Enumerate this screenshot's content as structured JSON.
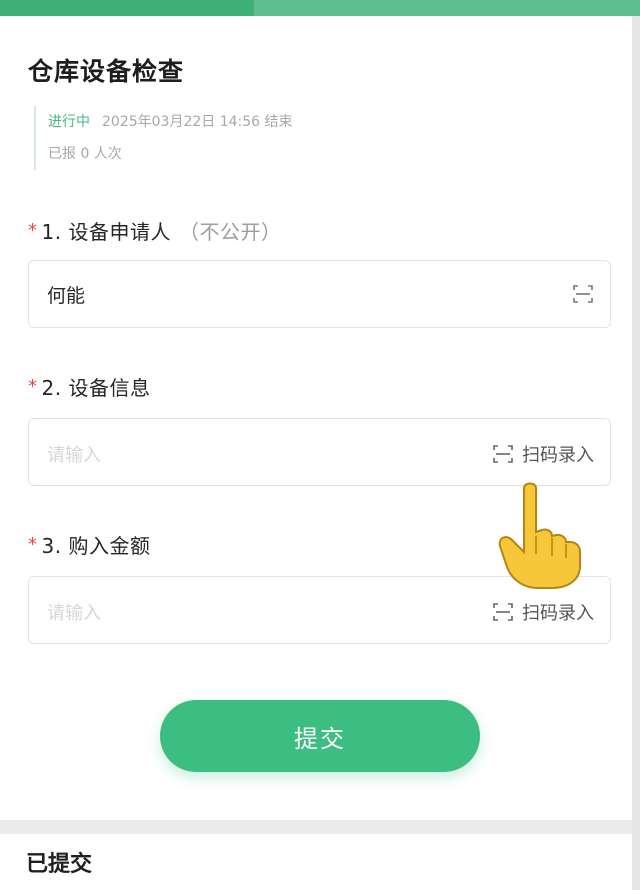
{
  "form": {
    "title": "仓库设备检查",
    "status": "进行中",
    "end_time": "2025年03月22日 14:56 结束",
    "reported": "已报 0 人次"
  },
  "questions": [
    {
      "star": "*",
      "label": "1. 设备申请人",
      "note": "（不公开）",
      "value": "何能"
    },
    {
      "star": "*",
      "label": "2. 设备信息",
      "placeholder": "请输入",
      "scan_label": "扫码录入"
    },
    {
      "star": "*",
      "label": "3. 购入金额",
      "placeholder": "请输入",
      "scan_label": "扫码录入"
    }
  ],
  "submit_label": "提交",
  "submitted_section": "已提交",
  "colors": {
    "accent": "#3cbd82",
    "required": "#e84545",
    "topbar": "#3fae79"
  },
  "icons": [
    "scan-icon",
    "pointing-hand-icon"
  ]
}
